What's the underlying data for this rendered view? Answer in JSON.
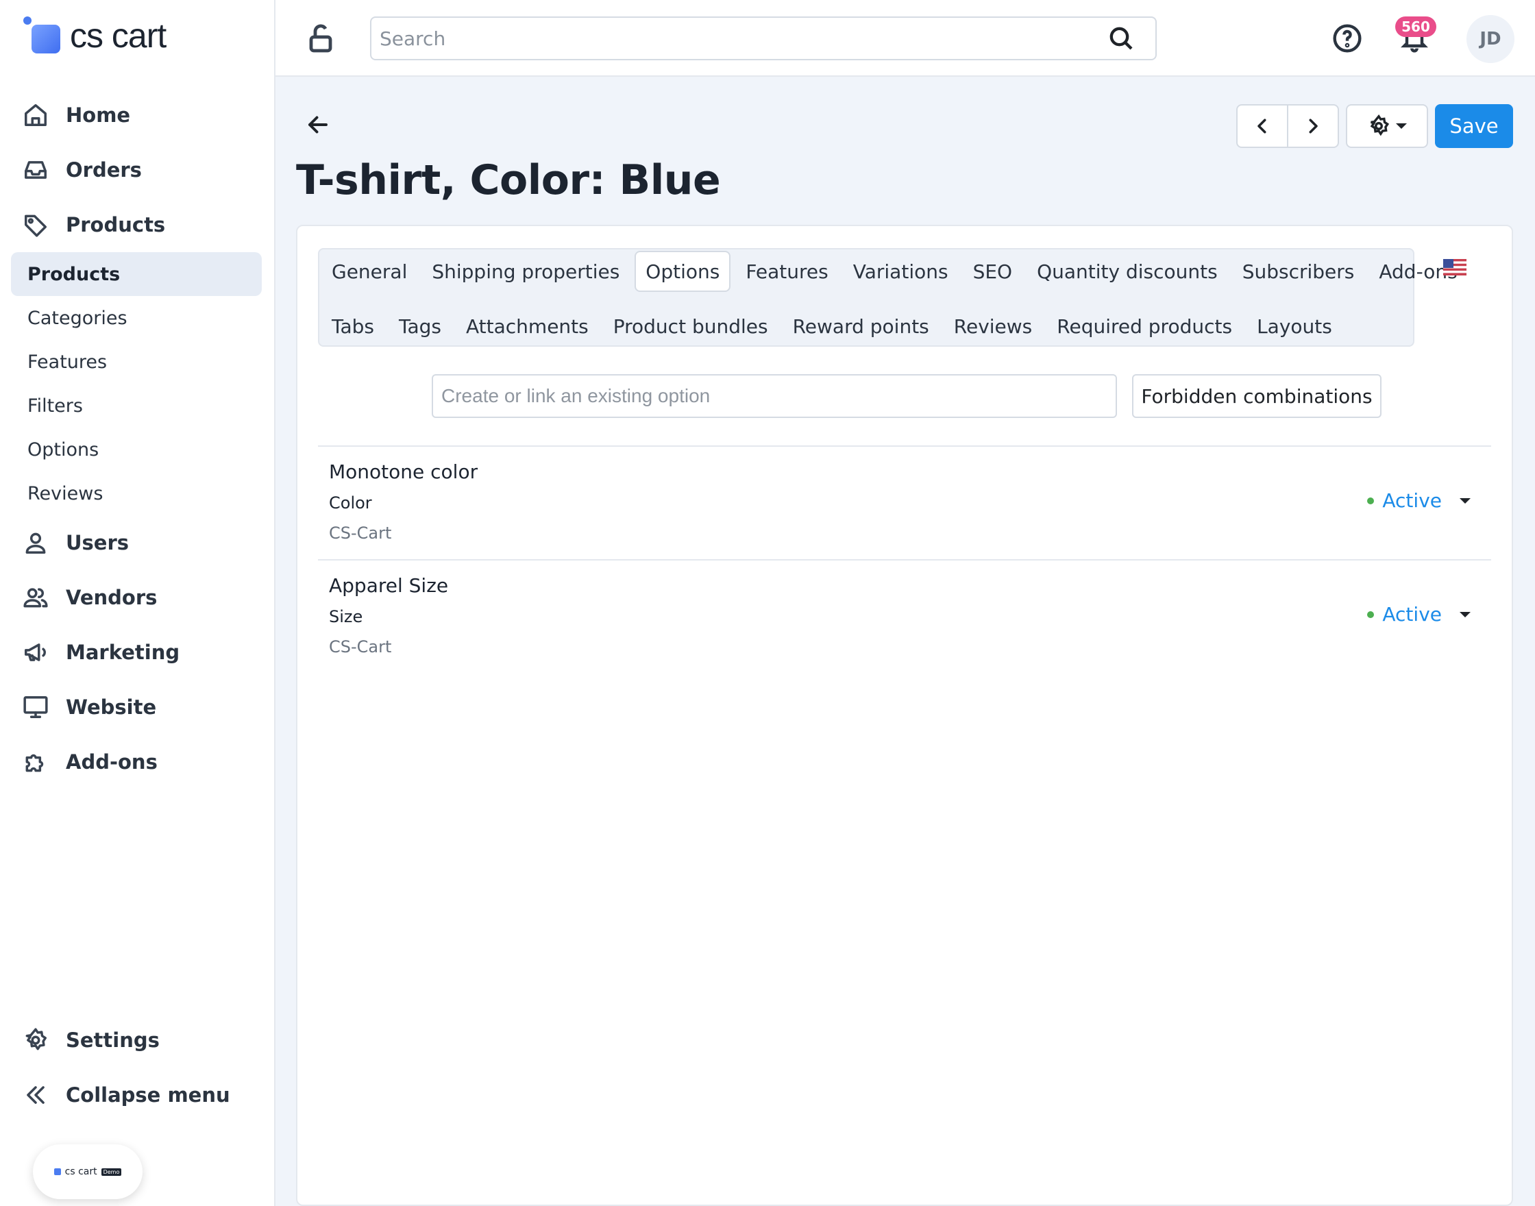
{
  "brand": {
    "logo_text": "cs cart",
    "demo_logo": "cs cart",
    "demo_badge": "Demo"
  },
  "sidebar": {
    "items": [
      {
        "label": "Home",
        "icon": "home-icon"
      },
      {
        "label": "Orders",
        "icon": "inbox-icon"
      },
      {
        "label": "Products",
        "icon": "tag-icon"
      }
    ],
    "products_sub": [
      "Products",
      "Categories",
      "Features",
      "Filters",
      "Options",
      "Reviews"
    ],
    "products_sub_active": "Products",
    "items_after": [
      {
        "label": "Users",
        "icon": "user-icon"
      },
      {
        "label": "Vendors",
        "icon": "users-icon"
      },
      {
        "label": "Marketing",
        "icon": "megaphone-icon"
      },
      {
        "label": "Website",
        "icon": "monitor-icon"
      },
      {
        "label": "Add-ons",
        "icon": "puzzle-icon"
      }
    ],
    "bottom": [
      {
        "label": "Settings",
        "icon": "gear-icon"
      },
      {
        "label": "Collapse menu",
        "icon": "double-chevron-left-icon"
      }
    ]
  },
  "header": {
    "search_placeholder": "Search",
    "notifications_count": "560",
    "avatar_initials": "JD"
  },
  "page": {
    "title": "T-shirt, Color: Blue",
    "save_label": "Save"
  },
  "tabs": {
    "row1": [
      "General",
      "Shipping properties",
      "Options",
      "Features",
      "Variations",
      "SEO",
      "Quantity discounts",
      "Subscribers",
      "Add-ons"
    ],
    "row2": [
      "Tabs",
      "Tags",
      "Attachments",
      "Product bundles",
      "Reward points",
      "Reviews",
      "Required products",
      "Layouts"
    ],
    "active": "Options"
  },
  "options_panel": {
    "input_placeholder": "Create or link an existing option",
    "forbidden_label": "Forbidden combinations",
    "rows": [
      {
        "name": "Monotone color",
        "internal": "Color",
        "vendor": "CS-Cart",
        "status": "Active"
      },
      {
        "name": "Apparel Size",
        "internal": "Size",
        "vendor": "CS-Cart",
        "status": "Active"
      }
    ]
  },
  "colors": {
    "accent": "#1b8be8",
    "status_active": "#4caf50",
    "badge": "#e94d8a"
  }
}
